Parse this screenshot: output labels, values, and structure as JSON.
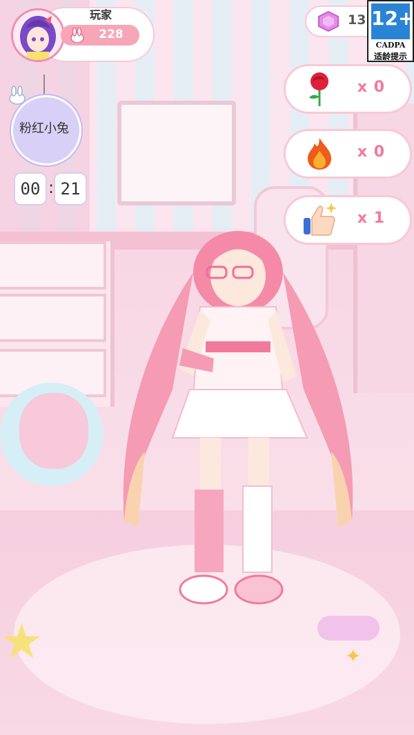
{
  "player": {
    "name": "玩家",
    "points": "228"
  },
  "gems": {
    "count": "13"
  },
  "age_rating": {
    "number": "12+",
    "org": "CADPA",
    "label": "适龄提示"
  },
  "theme": {
    "label": "粉红小兔"
  },
  "timer": {
    "minutes": "00",
    "seconds": "21",
    "separator": ":"
  },
  "reactions": [
    {
      "icon": "rose-icon",
      "count": "x 0"
    },
    {
      "icon": "fire-icon",
      "count": "x 0"
    },
    {
      "icon": "thumbs-up-icon",
      "count": "x 1"
    }
  ],
  "colors": {
    "accent_pink": "#f27a9c",
    "pill_border": "#f8c8d7",
    "theme_tag": "#d9d0f7",
    "age_badge_blue": "#2a84d6"
  }
}
